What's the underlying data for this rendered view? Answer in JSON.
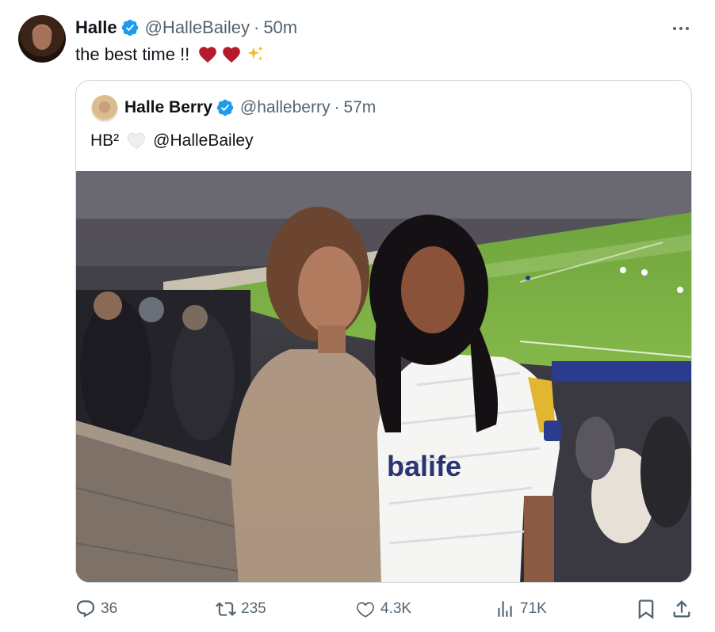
{
  "post": {
    "author_name": "Halle",
    "handle": "@HalleBailey",
    "separator": "·",
    "time": "50m",
    "text": "the best time !!"
  },
  "quoted": {
    "author_name": "Halle Berry",
    "handle": "@halleberry",
    "separator": "·",
    "time": "57m",
    "text_prefix": "HB²",
    "mention": "@HalleBailey"
  },
  "stats": {
    "replies": "36",
    "reposts": "235",
    "likes": "4.3K",
    "views": "71K"
  },
  "icons": {
    "verified": "verified-badge-icon",
    "more": "more-options-icon",
    "reply": "reply-icon",
    "repost": "repost-icon",
    "like": "heart-icon",
    "views": "views-icon",
    "bookmark": "bookmark-icon",
    "share": "share-icon"
  },
  "colors": {
    "verified_blue": "#1d9bf0",
    "secondary_text": "#536471",
    "heart_red": "#b51b2b"
  }
}
